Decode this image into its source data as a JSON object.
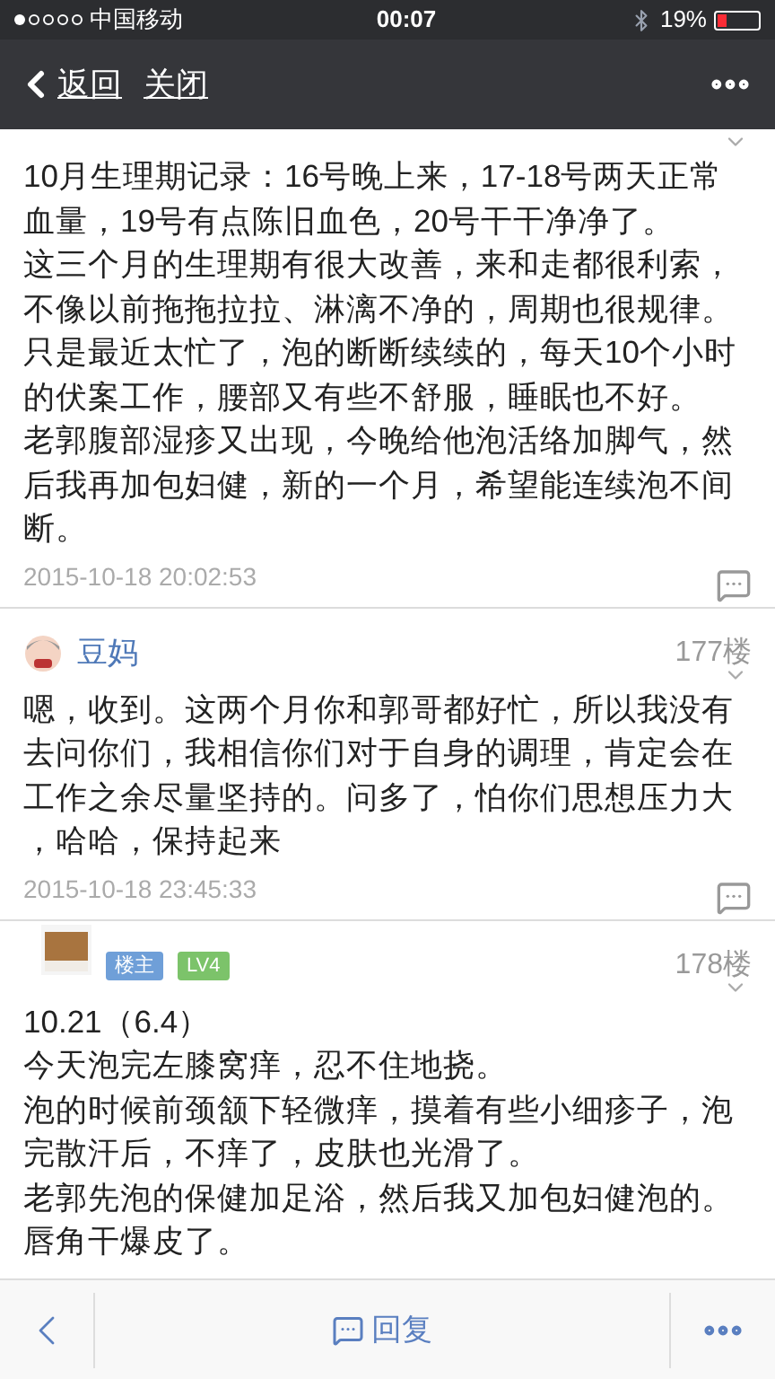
{
  "status_bar": {
    "carrier": "中国移动",
    "time": "00:07",
    "battery": "19%"
  },
  "nav": {
    "back": "返回",
    "close": "关闭"
  },
  "posts": [
    {
      "lines": [
        "10月生理期记录：16号晚上来，17-18号两天正常",
        "血量，19号有点陈旧血色，20号干干净净了。",
        "这三个月的生理期有很大改善，来和走都很利索，",
        "不像以前拖拖拉拉、淋漓不净的，周期也很规律。",
        "只是最近太忙了，泡的断断续续的，每天10个小时",
        "的伏案工作，腰部又有些不舒服，睡眠也不好。",
        "老郭腹部湿疹又出现，今晚给他泡活络加脚气，然",
        "后我再加包妇健，新的一个月，希望能连续泡不间",
        "断。"
      ],
      "timestamp": "2015-10-18 20:02:53"
    },
    {
      "author": "豆妈",
      "floor": "177楼",
      "lines": [
        "嗯，收到。这两个月你和郭哥都好忙，所以我没有",
        "去问你们，我相信你们对于自身的调理，肯定会在",
        "工作之余尽量坚持的。问多了，怕你们思想压力大",
        "，哈哈，保持起来"
      ],
      "timestamp": "2015-10-18 23:45:33"
    },
    {
      "floor": "178楼",
      "badges": [
        {
          "text": "楼主",
          "color": "#6f9fd8"
        },
        {
          "text": "LV4",
          "color": "#7cc36a"
        }
      ],
      "lines": [
        "10.21（6.4）",
        "今天泡完左膝窝痒，忍不住地挠。",
        "泡的时候前颈颔下轻微痒，摸着有些小细疹子，泡",
        "完散汗后，不痒了，皮肤也光滑了。",
        "老郭先泡的保健加足浴，然后我又加包妇健泡的。",
        "唇角干爆皮了。"
      ]
    }
  ],
  "bottom_bar": {
    "reply": "回复"
  }
}
